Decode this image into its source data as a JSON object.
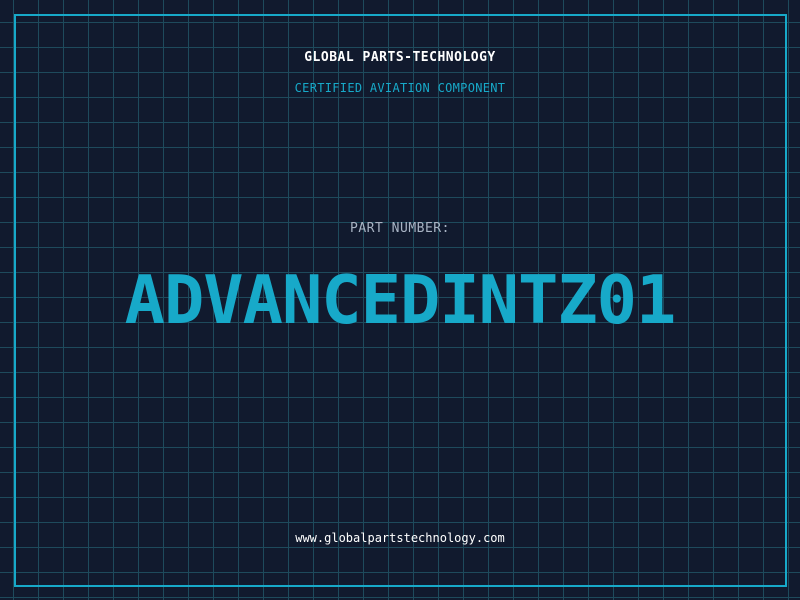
{
  "header": {
    "company": "GLOBAL PARTS-TECHNOLOGY",
    "subtitle": "CERTIFIED AVIATION COMPONENT"
  },
  "main": {
    "label": "PART NUMBER:",
    "part_number": "ADVANCEDINTZ01"
  },
  "footer": {
    "url": "www.globalpartstechnology.com"
  },
  "colors": {
    "background": "#111a2e",
    "accent": "#17a9c9",
    "grid": "#1e4a5c",
    "text": "#ffffff",
    "label": "#a9b4c4"
  }
}
